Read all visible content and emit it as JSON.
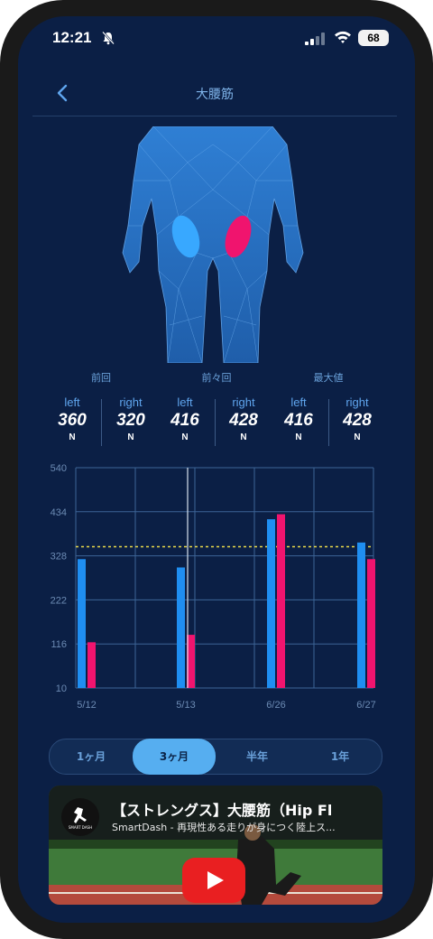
{
  "status": {
    "time": "12:21",
    "battery": "68"
  },
  "header": {
    "title": "大腰筋"
  },
  "groups": [
    "前回",
    "前々回",
    "最大値"
  ],
  "stats": [
    {
      "label": "left",
      "value": "360",
      "unit": "N"
    },
    {
      "label": "right",
      "value": "320",
      "unit": "N"
    },
    {
      "label": "left",
      "value": "416",
      "unit": "N"
    },
    {
      "label": "right",
      "value": "428",
      "unit": "N"
    },
    {
      "label": "left",
      "value": "416",
      "unit": "N"
    },
    {
      "label": "right",
      "value": "428",
      "unit": "N"
    }
  ],
  "chart_data": {
    "type": "bar",
    "categories": [
      "5/12",
      "5/13",
      "6/26",
      "6/27"
    ],
    "yticks": [
      "540",
      "434",
      "328",
      "222",
      "116",
      "10"
    ],
    "ylim": [
      10,
      540
    ],
    "series": [
      {
        "values": [
          320,
          300,
          416,
          360
        ],
        "color": "#1f8ef1"
      },
      {
        "values": [
          120,
          138,
          428,
          320
        ],
        "color": "#f0146e"
      }
    ],
    "reference_line": 350,
    "reference_color": "#e8d84a",
    "grid": true
  },
  "periods": [
    "1ヶ月",
    "3ヶ月",
    "半年",
    "1年"
  ],
  "active_period": "3ヶ月",
  "video": {
    "title": "【ストレングス】大腰筋（Hip Fl",
    "subtitle": "SmartDash - 再現性ある走りが身につく陸上ス..."
  },
  "colors": {
    "background": "#0b1f45",
    "left": "#1f8ef1",
    "right": "#f0146e",
    "accent": "#56aef0"
  }
}
